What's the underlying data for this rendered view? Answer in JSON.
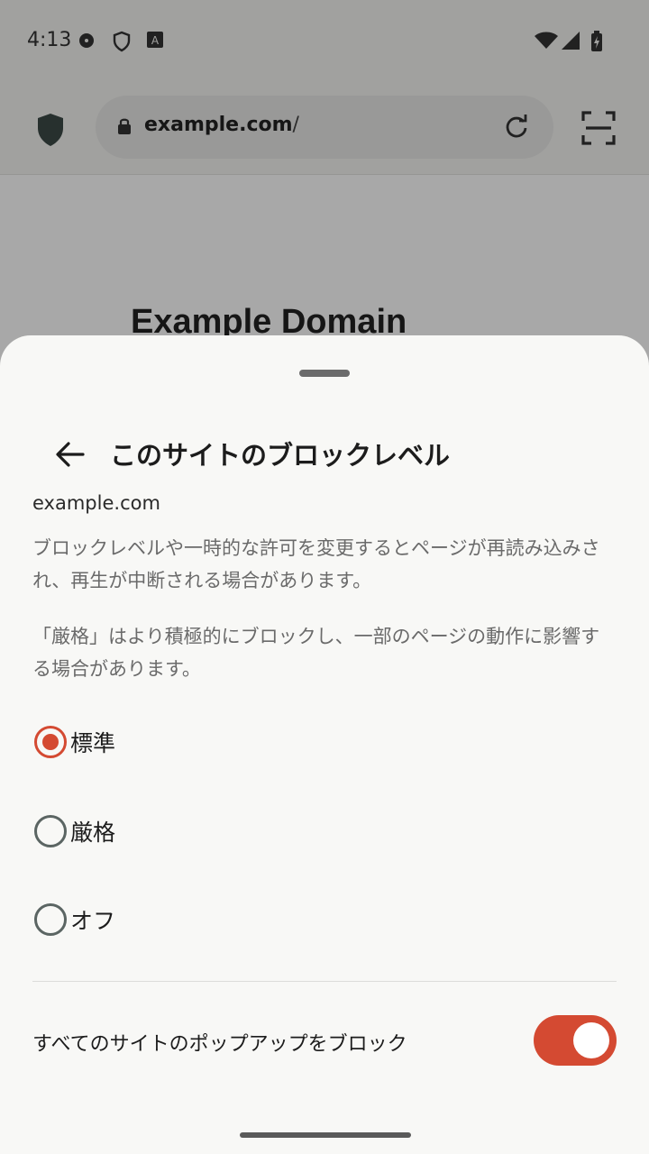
{
  "status_bar": {
    "time": "4:13"
  },
  "toolbar": {
    "url_domain": "example.com",
    "url_path": "/"
  },
  "page": {
    "heading": "Example Domain"
  },
  "sheet": {
    "title": "このサイトのブロックレベル",
    "site": "example.com",
    "description_1": "ブロックレベルや一時的な許可を変更するとページが再読み込みされ、再生が中断される場合があります。",
    "description_2": "「厳格」はより積極的にブロックし、一部のページの動作に影響する場合があります。",
    "options": [
      {
        "label": "標準",
        "selected": true
      },
      {
        "label": "厳格",
        "selected": false
      },
      {
        "label": "オフ",
        "selected": false
      }
    ],
    "popup_block_label": "すべてのサイトのポップアップをブロック",
    "popup_block_enabled": true
  },
  "colors": {
    "accent": "#d44a32",
    "sheet_bg": "#f8f8f6"
  }
}
